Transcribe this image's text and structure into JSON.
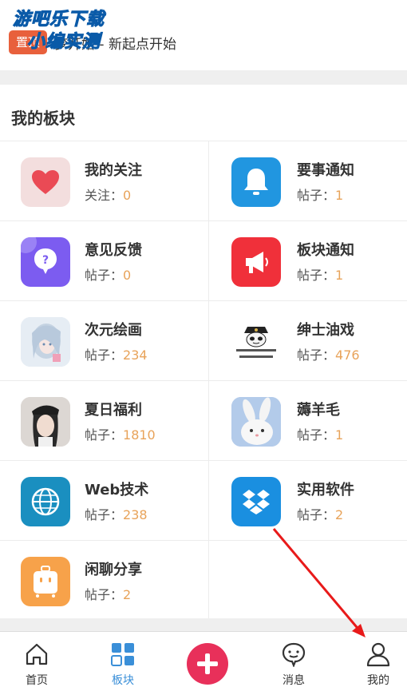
{
  "pinned": {
    "badge": "置顶",
    "text": "梦开始 - 新起点开始"
  },
  "watermark": {
    "line1": "游吧乐下载",
    "line2": "小编实测"
  },
  "section": {
    "title": "我的板块"
  },
  "boards": [
    {
      "name": "我的关注",
      "stat_label": "关注：",
      "stat_value": "0",
      "icon": "heart-icon",
      "color": "#f3d9d9"
    },
    {
      "name": "要事通知",
      "stat_label": "帖子：",
      "stat_value": "1",
      "icon": "bell-icon",
      "color": "#2196e0"
    },
    {
      "name": "意见反馈",
      "stat_label": "帖子：",
      "stat_value": "0",
      "icon": "question-bubble-icon",
      "color": "#7c5cf0"
    },
    {
      "name": "板块通知",
      "stat_label": "帖子：",
      "stat_value": "1",
      "icon": "megaphone-icon",
      "color": "#f0303a"
    },
    {
      "name": "次元绘画",
      "stat_label": "帖子：",
      "stat_value": "234",
      "icon": "anime-girl-image",
      "color": "#c9d8e8"
    },
    {
      "name": "绅士油戏",
      "stat_label": "帖子：",
      "stat_value": "476",
      "icon": "panda-meme-image",
      "color": "#ffffff"
    },
    {
      "name": "夏日福利",
      "stat_label": "帖子：",
      "stat_value": "1810",
      "icon": "girl-photo-image",
      "color": "#3b3b3b"
    },
    {
      "name": "薅羊毛",
      "stat_label": "帖子：",
      "stat_value": "1",
      "icon": "rabbit-image",
      "color": "#a9c4e8"
    },
    {
      "name": "Web技术",
      "stat_label": "帖子：",
      "stat_value": "238",
      "icon": "globe-icon",
      "color": "#1a8fc0"
    },
    {
      "name": "实用软件",
      "stat_label": "帖子：",
      "stat_value": "2",
      "icon": "dropbox-icon",
      "color": "#1a8fe0"
    },
    {
      "name": "闲聊分享",
      "stat_label": "帖子：",
      "stat_value": "2",
      "icon": "suitcase-icon",
      "color": "#f7a24a"
    }
  ],
  "nav": {
    "home": "首页",
    "boards": "板块",
    "messages": "消息",
    "mine": "我的",
    "accent": "#3a8fd8",
    "post_color": "#e8305a"
  }
}
